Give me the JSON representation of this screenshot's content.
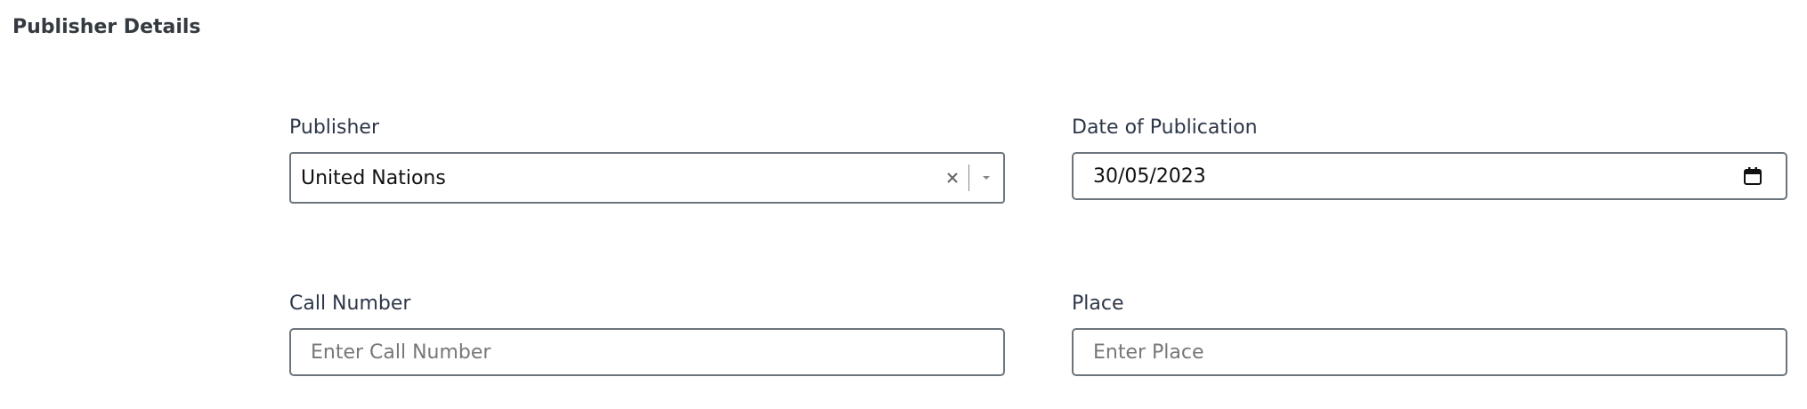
{
  "section": {
    "title": "Publisher Details"
  },
  "publisher": {
    "label": "Publisher",
    "value": "United Nations",
    "clear_icon": "close-icon",
    "dropdown_icon": "chevron-down-icon"
  },
  "date_of_publication": {
    "label": "Date of Publication",
    "value": "30/05/2023",
    "calendar_icon": "calendar-icon"
  },
  "call_number": {
    "label": "Call Number",
    "placeholder": "Enter Call Number",
    "value": ""
  },
  "place": {
    "label": "Place",
    "placeholder": "Enter Place",
    "value": ""
  }
}
